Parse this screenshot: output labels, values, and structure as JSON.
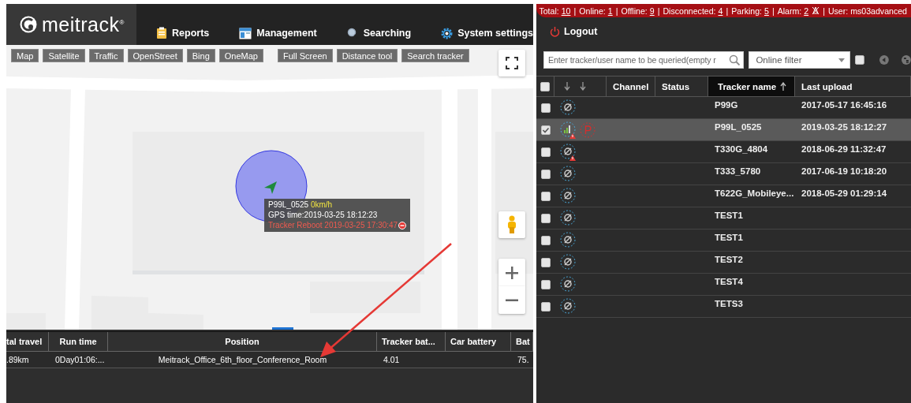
{
  "header": {
    "logo": "meitrack$^{®}$",
    "nav": [
      {
        "label": "Reports"
      },
      {
        "label": "Management"
      },
      {
        "label": "Searching"
      },
      {
        "label": "System settings"
      }
    ]
  },
  "status_bar": {
    "separator": "|",
    "items": [
      {
        "kind": "count",
        "label": "Total:",
        "count": "10"
      },
      {
        "kind": "count",
        "label": "Online:",
        "count": "1"
      },
      {
        "kind": "count",
        "label": "Offline:",
        "count": "9"
      },
      {
        "kind": "count",
        "label": "Disconnected:",
        "count": "4"
      },
      {
        "kind": "count",
        "label": "Parking:",
        "count": "5"
      },
      {
        "kind": "alarm",
        "label": "Alarm:",
        "count": "2"
      }
    ],
    "user": "User: ms03advanced"
  },
  "logout": "Logout",
  "map": {
    "layers": [
      "Map",
      "Satellite",
      "Traffic",
      "OpenStreet",
      "Bing",
      "OneMap"
    ],
    "tools": [
      "Full Screen",
      "Distance tool",
      "Search tracker"
    ],
    "popup": {
      "name": "P99L_0525",
      "speed": "0km/h",
      "gps_time": "GPS time:2019-03-25 18:12:23",
      "alarm": "Tracker Reboot 2019-03-25 17:30:47"
    }
  },
  "bottom_table": {
    "columns": [
      "tal travel",
      "Run time",
      "Position",
      "Tracker bat...",
      "Car battery",
      "Bat"
    ],
    "rows": [
      [
        ".89km",
        "0Day01:06:...",
        "Meitrack_Office_6th_floor_Conference_Room",
        "4.01",
        "",
        "75."
      ]
    ]
  },
  "tracker_panel": {
    "search": {
      "placeholder": "Enter tracker/user name to be queried(empty r"
    },
    "filter": {
      "value": "Online filter"
    },
    "show_checked": false,
    "columns": [
      {
        "label": "Channel",
        "sorted": false
      },
      {
        "label": "Status",
        "sorted": false
      },
      {
        "label": "Tracker name",
        "sorted": true
      },
      {
        "label": "Last upload",
        "sorted": false
      }
    ],
    "all_checked": false,
    "rows": [
      {
        "name": "P99G",
        "last_upload": "2017-05-17 16:45:16",
        "checked": false,
        "selected": false,
        "kind": "offline",
        "alarm": false,
        "parking": false
      },
      {
        "name": "P99L_0525",
        "last_upload": "2019-03-25 18:12:27",
        "checked": true,
        "selected": true,
        "kind": "online",
        "alarm": true,
        "parking": true
      },
      {
        "name": "T330G_4804",
        "last_upload": "2018-06-29 11:32:47",
        "checked": false,
        "selected": false,
        "kind": "offline",
        "alarm": true,
        "parking": false
      },
      {
        "name": "T333_5780",
        "last_upload": "2017-06-19 10:18:20",
        "checked": false,
        "selected": false,
        "kind": "offline",
        "alarm": false,
        "parking": false
      },
      {
        "name": "T622G_Mobileye...",
        "last_upload": "2018-05-29 01:29:14",
        "checked": false,
        "selected": false,
        "kind": "offline",
        "alarm": false,
        "parking": false
      },
      {
        "name": "TEST1",
        "checked": false,
        "selected": false,
        "kind": "offline",
        "alarm": false,
        "parking": false
      },
      {
        "name": "TEST1",
        "checked": false,
        "selected": false,
        "kind": "offline",
        "alarm": false,
        "parking": false
      },
      {
        "name": "TEST2",
        "checked": false,
        "selected": false,
        "kind": "offline",
        "alarm": false,
        "parking": false
      },
      {
        "name": "TEST4",
        "checked": false,
        "selected": false,
        "kind": "offline",
        "alarm": false,
        "parking": false
      },
      {
        "name": "TETS3",
        "checked": false,
        "selected": false,
        "kind": "offline",
        "alarm": false,
        "parking": false
      }
    ]
  }
}
